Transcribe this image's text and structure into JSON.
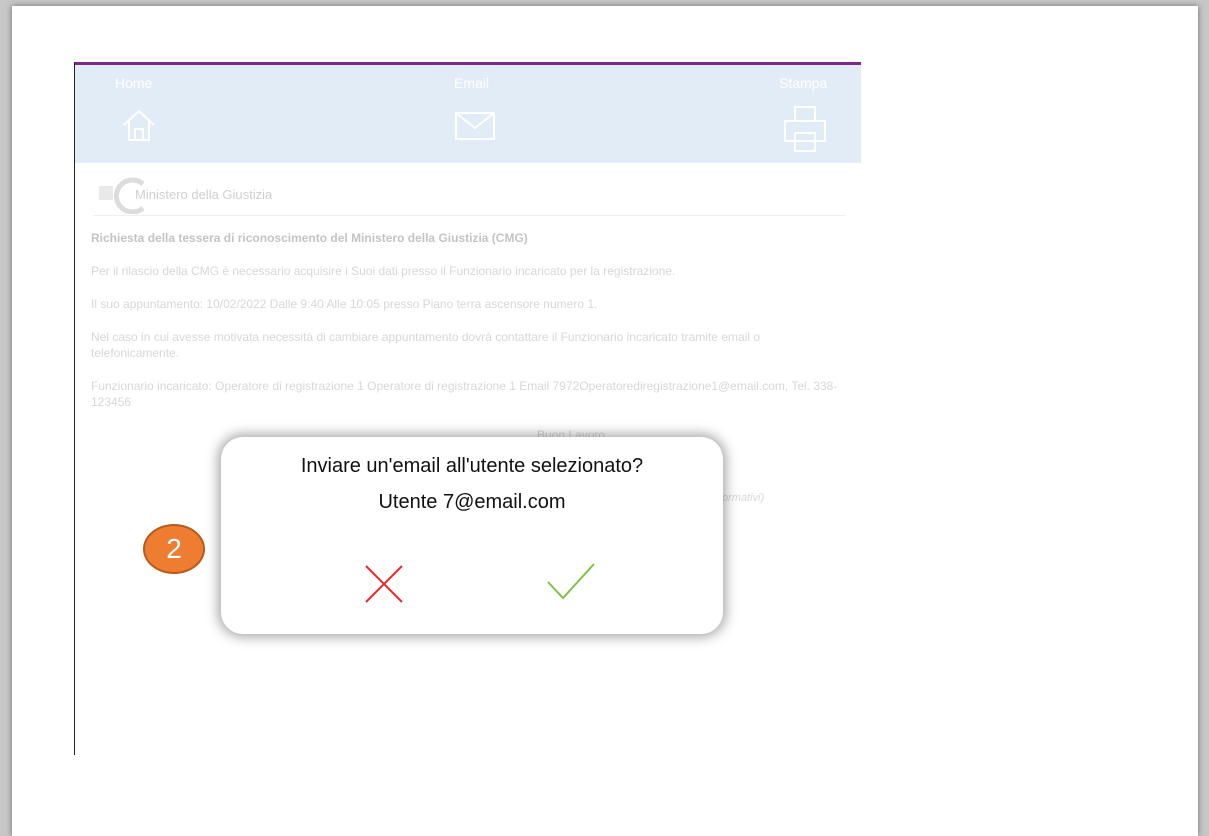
{
  "nav": {
    "home_label": "Home",
    "email_label": "Email",
    "print_label": "Stampa"
  },
  "logo": {
    "text": "Ministero della Giustizia"
  },
  "document": {
    "title": "Richiesta della tessera di riconoscimento del Ministero della Giustizia (CMG)",
    "para1": "Per il rilascio della CMG è necessario acquisire i Suoi dati presso il Funzionario incaricato per la registrazione.",
    "para2": "Il suo appuntamento: 10/02/2022 Dalle 9:40 Alle 10:05 presso Piano terra ascensore numero 1.",
    "para3": "Nel caso in cui avesse motivata necessità di cambiare appuntamento dovrà contattare il Funzionario incaricato tramite email o telefonicamente.",
    "para4": "Funzionario incaricato: Operatore di registrazione 1 Operatore di registrazione 1 Email 7972Operatorediregistrazione1@email.com, Tel. 338-123456",
    "closing": "Buon Lavoro",
    "note": "ormativi)"
  },
  "dialog": {
    "question": "Inviare un'email all'utente selezionato?",
    "user": "Utente 7@email.com"
  },
  "step_badge": {
    "number": "2"
  },
  "colors": {
    "accent": "#7b2a8c",
    "topbar": "#e2ecf7",
    "cancel": "#e8262b",
    "confirm": "#7dc242",
    "badge": "#ee7d32"
  },
  "icons": {
    "home": "home-icon",
    "email": "envelope-icon",
    "print": "printer-icon",
    "cancel": "close-icon",
    "confirm": "check-icon"
  }
}
